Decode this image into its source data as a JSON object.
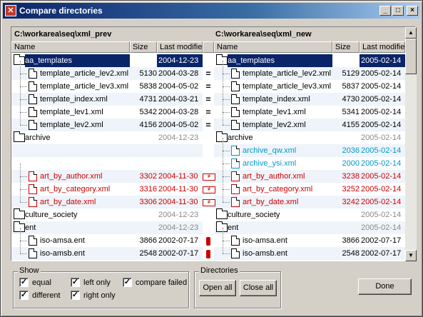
{
  "window": {
    "title": "Compare directories",
    "minimize": "_",
    "maximize": "□",
    "close": "×"
  },
  "left": {
    "path": "C:\\workarea\\seq\\xml_prev",
    "col_name": "Name",
    "col_size": "Size",
    "col_modified": "Last modifie"
  },
  "right": {
    "path": "C:\\workarea\\seq\\xml_new",
    "col_name": "Name",
    "col_size": "Size",
    "col_modified": "Last modifie"
  },
  "rows": [
    {
      "l_name": "aa_templates",
      "l_size": "",
      "l_date": "2004-12-23",
      "mid": "",
      "r_name": "aa_templates",
      "r_size": "",
      "r_date": "2005-02-14",
      "type": "dir",
      "level": 0,
      "selected": true,
      "style": ""
    },
    {
      "l_name": "template_article_lev2.xml",
      "l_size": "5130",
      "l_date": "2004-03-28",
      "mid": "=",
      "r_name": "template_article_lev2.xml",
      "r_size": "5129",
      "r_date": "2005-02-14",
      "type": "file",
      "level": 1,
      "style": ""
    },
    {
      "l_name": "template_article_lev3.xml",
      "l_size": "5838",
      "l_date": "2004-05-02",
      "mid": "=",
      "r_name": "template_article_lev3.xml",
      "r_size": "5837",
      "r_date": "2005-02-14",
      "type": "file",
      "level": 1,
      "style": ""
    },
    {
      "l_name": "template_index.xml",
      "l_size": "4731",
      "l_date": "2004-03-21",
      "mid": "=",
      "r_name": "template_index.xml",
      "r_size": "4730",
      "r_date": "2005-02-14",
      "type": "file",
      "level": 1,
      "style": ""
    },
    {
      "l_name": "template_lev1.xml",
      "l_size": "5342",
      "l_date": "2004-03-28",
      "mid": "=",
      "r_name": "template_lev1.xml",
      "r_size": "5341",
      "r_date": "2005-02-14",
      "type": "file",
      "level": 1,
      "style": ""
    },
    {
      "l_name": "template_lev2.xml",
      "l_size": "4156",
      "l_date": "2004-05-02",
      "mid": "=",
      "r_name": "template_lev2.xml",
      "r_size": "4155",
      "r_date": "2005-02-14",
      "type": "file",
      "level": 1,
      "style": ""
    },
    {
      "l_name": "archive",
      "l_size": "",
      "l_date": "2004-12-23",
      "mid": "",
      "r_name": "archive",
      "r_size": "",
      "r_date": "2005-02-14",
      "type": "dir",
      "level": 0,
      "style": "datesgrey"
    },
    {
      "l_name": "",
      "l_size": "",
      "l_date": "",
      "mid": "",
      "r_name": "archive_qw.xml",
      "r_size": "2036",
      "r_date": "2005-02-14",
      "type": "file",
      "level": 1,
      "style": "rightonly"
    },
    {
      "l_name": "",
      "l_size": "",
      "l_date": "",
      "mid": "",
      "r_name": "archive_ysi.xml",
      "r_size": "2000",
      "r_date": "2005-02-14",
      "type": "file",
      "level": 1,
      "style": "rightonly"
    },
    {
      "l_name": "art_by_author.xml",
      "l_size": "3302",
      "l_date": "2004-11-30",
      "mid": "neq",
      "r_name": "art_by_author.xml",
      "r_size": "3238",
      "r_date": "2005-02-14",
      "type": "file",
      "level": 1,
      "style": "diff"
    },
    {
      "l_name": "art_by_category.xml",
      "l_size": "3316",
      "l_date": "2004-11-30",
      "mid": "neq",
      "r_name": "art_by_category.xml",
      "r_size": "3252",
      "r_date": "2005-02-14",
      "type": "file",
      "level": 1,
      "style": "diff"
    },
    {
      "l_name": "art_by_date.xml",
      "l_size": "3306",
      "l_date": "2004-11-30",
      "mid": "neq",
      "r_name": "art_by_date.xml",
      "r_size": "3242",
      "r_date": "2005-02-14",
      "type": "file",
      "level": 1,
      "style": "diff"
    },
    {
      "l_name": "culture_society",
      "l_size": "",
      "l_date": "2004-12-23",
      "mid": "",
      "r_name": "culture_society",
      "r_size": "",
      "r_date": "2005-02-14",
      "type": "dir",
      "level": 0,
      "style": "datesgrey"
    },
    {
      "l_name": "ent",
      "l_size": "",
      "l_date": "2004-12-23",
      "mid": "",
      "r_name": "ent",
      "r_size": "",
      "r_date": "2005-02-14",
      "type": "dir",
      "level": 0,
      "style": "datesgrey"
    },
    {
      "l_name": "iso-amsa.ent",
      "l_size": "3866",
      "l_date": "2002-07-17",
      "mid": "bar",
      "r_name": "iso-amsa.ent",
      "r_size": "3866",
      "r_date": "2002-07-17",
      "type": "file",
      "level": 1,
      "style": ""
    },
    {
      "l_name": "iso-amsb.ent",
      "l_size": "2548",
      "l_date": "2002-07-17",
      "mid": "bar",
      "r_name": "iso-amsb.ent",
      "r_size": "2548",
      "r_date": "2002-07-17",
      "type": "file",
      "level": 1,
      "style": ""
    }
  ],
  "show": {
    "label": "Show",
    "equal": "equal",
    "different": "different",
    "left_only": "left only",
    "right_only": "right only",
    "compare_failed": "compare failed",
    "check": "✓"
  },
  "directories": {
    "label": "Directories",
    "open_all": "Open all",
    "close_all": "Close all"
  },
  "done": "Done",
  "colors": {
    "selection": "#0a246a",
    "different": "#cc0000",
    "right_only": "#0099cc"
  }
}
